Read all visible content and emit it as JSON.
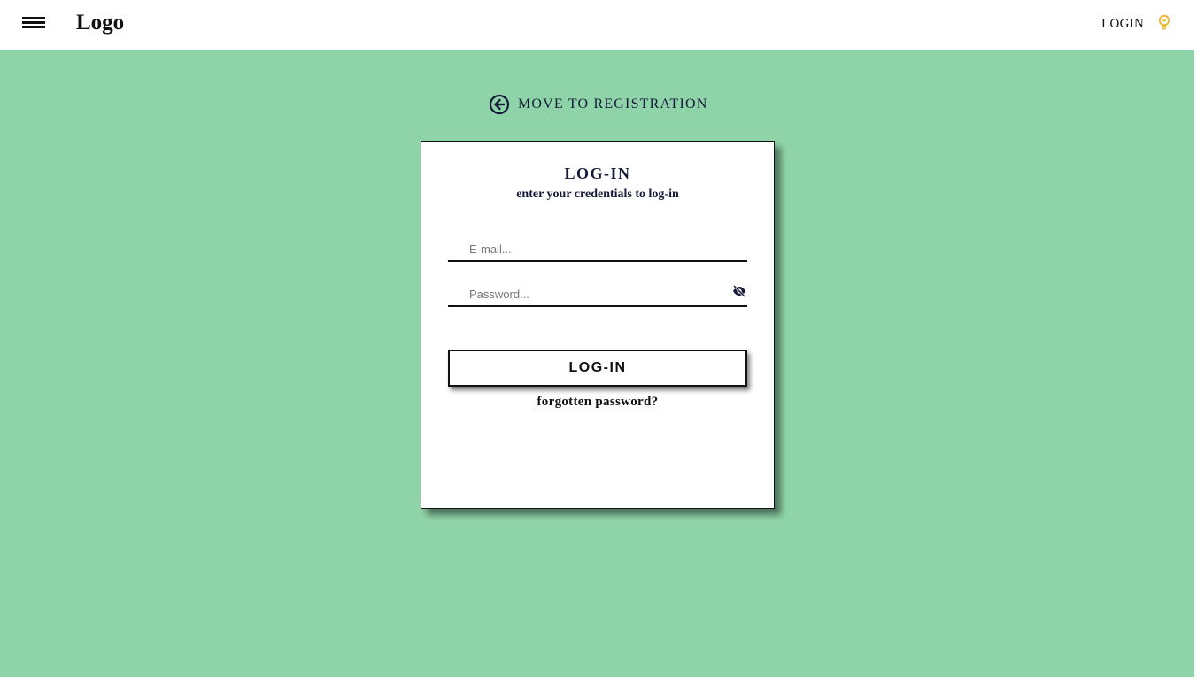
{
  "header": {
    "logo": "Logo",
    "login_label": "LOGIN",
    "menu_icon": "hamburger-menu-icon",
    "bulb_icon": "lightbulb-icon",
    "bulb_color": "#f0b428"
  },
  "main": {
    "background": "#8fd4a8",
    "back_link": {
      "label": "MOVE TO REGISTRATION",
      "icon": "arrow-left-circle-icon"
    },
    "card": {
      "title": "LOG-IN",
      "subtitle": "enter your credentials to log-in",
      "email_placeholder": "E-mail...",
      "email_value": "",
      "password_placeholder": "Password...",
      "password_value": "",
      "password_toggle_icon": "eye-slash-icon",
      "submit_label": "LOG-IN",
      "forgot_label": "forgotten password?"
    }
  }
}
